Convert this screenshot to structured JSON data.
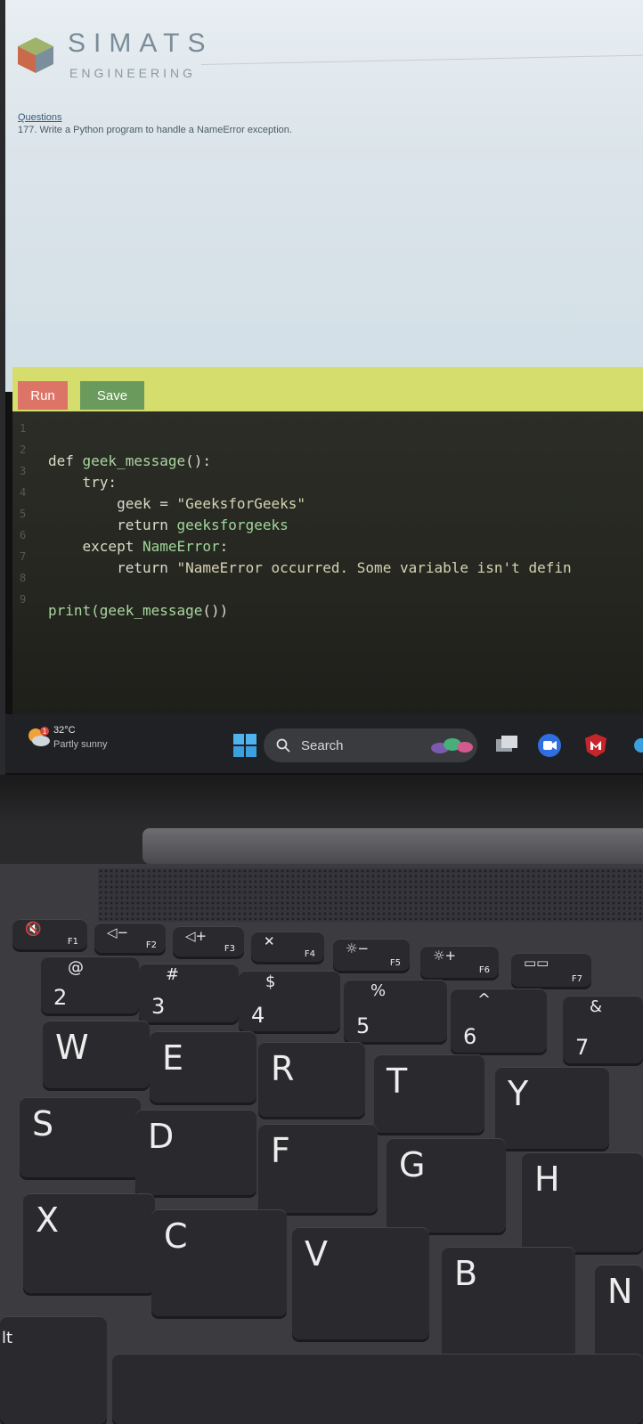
{
  "brand": {
    "line1": "SIMATS",
    "line2": "ENGINEERING"
  },
  "question": {
    "label": "Questions",
    "text": "177. Write a Python program to handle a NameError exception."
  },
  "toolbar": {
    "run_label": "Run",
    "save_label": "Save"
  },
  "editor": {
    "line_numbers": [
      "1",
      "2",
      "3",
      "4",
      "5",
      "6",
      "7",
      "8",
      "9"
    ],
    "lines": [
      {
        "kw": "def ",
        "fn": "geek_message",
        "rest": "():"
      },
      {
        "kw": "    try:",
        "fn": "",
        "rest": ""
      },
      {
        "kw": "        geek = ",
        "fn": "",
        "rest": "\"GeeksforGeeks\""
      },
      {
        "kw": "        return ",
        "fn": "geeksforgeeks",
        "rest": ""
      },
      {
        "kw": "    except ",
        "fn": "NameError",
        "rest": ":"
      },
      {
        "kw": "        return ",
        "fn": "",
        "rest": "\"NameError occurred. Some variable isn't defin"
      },
      {
        "kw": "",
        "fn": "",
        "rest": ""
      },
      {
        "kw": "",
        "fn": "print(geek_message",
        "rest": "())"
      },
      {
        "kw": "",
        "fn": "",
        "rest": ""
      }
    ]
  },
  "taskbar": {
    "weather_temp": "32°C",
    "weather_desc": "Partly sunny",
    "weather_badge": "1",
    "search_placeholder": "Search"
  },
  "keyboard": {
    "function_keys": [
      {
        "label": "F1",
        "glyph": "🔇"
      },
      {
        "label": "F2",
        "glyph": "◁−"
      },
      {
        "label": "F3",
        "glyph": "◁+"
      },
      {
        "label": "F4",
        "glyph": "✕"
      },
      {
        "label": "F5",
        "glyph": "☼−"
      },
      {
        "label": "F6",
        "glyph": "☼+"
      },
      {
        "label": "F7",
        "glyph": "▭▭"
      }
    ],
    "number_keys": [
      {
        "num": "2",
        "sym": "@"
      },
      {
        "num": "3",
        "sym": "#"
      },
      {
        "num": "4",
        "sym": "$"
      },
      {
        "num": "5",
        "sym": "%"
      },
      {
        "num": "6",
        "sym": "^"
      },
      {
        "num": "7",
        "sym": "&"
      }
    ],
    "row_qwerty": [
      "W",
      "E",
      "R",
      "T",
      "Y"
    ],
    "row_home": [
      "S",
      "D",
      "F",
      "G",
      "H"
    ],
    "row_bottom": [
      "X",
      "C",
      "V",
      "B",
      "N"
    ],
    "alt_label": "lt"
  },
  "colors": {
    "run_button": "#dc7468",
    "save_button": "#6a9a5c",
    "toolbar": "#d5dd6c",
    "editor_bg": "#2c2d27"
  }
}
